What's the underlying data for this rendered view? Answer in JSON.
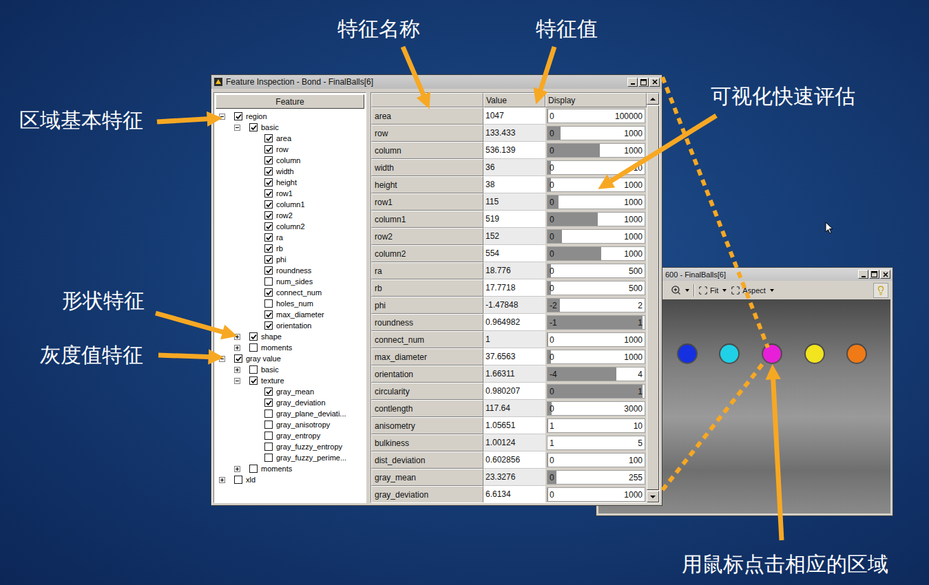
{
  "main_window": {
    "title": "Feature Inspection - Bond - FinalBalls[6]",
    "tree_header": "Feature",
    "tree": [
      {
        "label": "region",
        "kind": "branch",
        "level": 0,
        "expanded": true,
        "checked": true
      },
      {
        "label": "basic",
        "kind": "branch",
        "level": 1,
        "expanded": true,
        "checked": true
      },
      {
        "label": "area",
        "kind": "leaf",
        "level": 2,
        "checked": true
      },
      {
        "label": "row",
        "kind": "leaf",
        "level": 2,
        "checked": true
      },
      {
        "label": "column",
        "kind": "leaf",
        "level": 2,
        "checked": true
      },
      {
        "label": "width",
        "kind": "leaf",
        "level": 2,
        "checked": true
      },
      {
        "label": "height",
        "kind": "leaf",
        "level": 2,
        "checked": true
      },
      {
        "label": "row1",
        "kind": "leaf",
        "level": 2,
        "checked": true
      },
      {
        "label": "column1",
        "kind": "leaf",
        "level": 2,
        "checked": true
      },
      {
        "label": "row2",
        "kind": "leaf",
        "level": 2,
        "checked": true
      },
      {
        "label": "column2",
        "kind": "leaf",
        "level": 2,
        "checked": true
      },
      {
        "label": "ra",
        "kind": "leaf",
        "level": 2,
        "checked": true
      },
      {
        "label": "rb",
        "kind": "leaf",
        "level": 2,
        "checked": true
      },
      {
        "label": "phi",
        "kind": "leaf",
        "level": 2,
        "checked": true
      },
      {
        "label": "roundness",
        "kind": "leaf",
        "level": 2,
        "checked": true
      },
      {
        "label": "num_sides",
        "kind": "leaf",
        "level": 2,
        "checked": false
      },
      {
        "label": "connect_num",
        "kind": "leaf",
        "level": 2,
        "checked": true
      },
      {
        "label": "holes_num",
        "kind": "leaf",
        "level": 2,
        "checked": false
      },
      {
        "label": "max_diameter",
        "kind": "leaf",
        "level": 2,
        "checked": true
      },
      {
        "label": "orientation",
        "kind": "leaf",
        "level": 2,
        "checked": true
      },
      {
        "label": "shape",
        "kind": "branch",
        "level": 1,
        "expanded": false,
        "checked": true
      },
      {
        "label": "moments",
        "kind": "branch",
        "level": 1,
        "expanded": false,
        "checked": false
      },
      {
        "label": "gray value",
        "kind": "branch",
        "level": 0,
        "expanded": true,
        "checked": true
      },
      {
        "label": "basic",
        "kind": "branch",
        "level": 1,
        "expanded": false,
        "checked": false
      },
      {
        "label": "texture",
        "kind": "branch",
        "level": 1,
        "expanded": true,
        "checked": true
      },
      {
        "label": "gray_mean",
        "kind": "leaf",
        "level": 2,
        "checked": true
      },
      {
        "label": "gray_deviation",
        "kind": "leaf",
        "level": 2,
        "checked": true
      },
      {
        "label": "gray_plane_deviati...",
        "kind": "leaf",
        "level": 2,
        "checked": false
      },
      {
        "label": "gray_anisotropy",
        "kind": "leaf",
        "level": 2,
        "checked": false
      },
      {
        "label": "gray_entropy",
        "kind": "leaf",
        "level": 2,
        "checked": false
      },
      {
        "label": "gray_fuzzy_entropy",
        "kind": "leaf",
        "level": 2,
        "checked": false
      },
      {
        "label": "gray_fuzzy_perime...",
        "kind": "leaf",
        "level": 2,
        "checked": false
      },
      {
        "label": "moments",
        "kind": "branch",
        "level": 1,
        "expanded": false,
        "checked": false
      },
      {
        "label": "xld",
        "kind": "branch",
        "level": 0,
        "expanded": false,
        "checked": false
      }
    ],
    "table": {
      "columns": [
        "Value",
        "Display"
      ],
      "rows": [
        {
          "feature": "area",
          "value": "1047",
          "min": "0",
          "max": "100000",
          "level": 0.0105
        },
        {
          "feature": "row",
          "value": "133.433",
          "min": "0",
          "max": "1000",
          "level": 0.133
        },
        {
          "feature": "column",
          "value": "536.139",
          "min": "0",
          "max": "1000",
          "level": 0.536
        },
        {
          "feature": "width",
          "value": "36",
          "min": "0",
          "max": "10",
          "level": 0.036
        },
        {
          "feature": "height",
          "value": "38",
          "min": "0",
          "max": "1000",
          "level": 0.038
        },
        {
          "feature": "row1",
          "value": "115",
          "min": "0",
          "max": "1000",
          "level": 0.115
        },
        {
          "feature": "column1",
          "value": "519",
          "min": "0",
          "max": "1000",
          "level": 0.519
        },
        {
          "feature": "row2",
          "value": "152",
          "min": "0",
          "max": "1000",
          "level": 0.152
        },
        {
          "feature": "column2",
          "value": "554",
          "min": "0",
          "max": "1000",
          "level": 0.554
        },
        {
          "feature": "ra",
          "value": "18.776",
          "min": "0",
          "max": "500",
          "level": 0.0376
        },
        {
          "feature": "rb",
          "value": "17.7718",
          "min": "0",
          "max": "500",
          "level": 0.0355
        },
        {
          "feature": "phi",
          "value": "-1.47848",
          "min": "-2",
          "max": "2",
          "level": 0.13
        },
        {
          "feature": "roundness",
          "value": "0.964982",
          "min": "-1",
          "max": "1",
          "level": 0.982
        },
        {
          "feature": "connect_num",
          "value": "1",
          "min": "0",
          "max": "1000",
          "level": 0.001
        },
        {
          "feature": "max_diameter",
          "value": "37.6563",
          "min": "0",
          "max": "1000",
          "level": 0.0377
        },
        {
          "feature": "orientation",
          "value": "1.66311",
          "min": "-4",
          "max": "4",
          "level": 0.708
        },
        {
          "feature": "circularity",
          "value": "0.980207",
          "min": "0",
          "max": "1",
          "level": 0.98
        },
        {
          "feature": "contlength",
          "value": "117.64",
          "min": "0",
          "max": "3000",
          "level": 0.0392
        },
        {
          "feature": "anisometry",
          "value": "1.05651",
          "min": "1",
          "max": "10",
          "level": 0.0063
        },
        {
          "feature": "bulkiness",
          "value": "1.00124",
          "min": "1",
          "max": "5",
          "level": 0.0003
        },
        {
          "feature": "dist_deviation",
          "value": "0.602856",
          "min": "0",
          "max": "100",
          "level": 0.006
        },
        {
          "feature": "gray_mean",
          "value": "23.3276",
          "min": "0",
          "max": "255",
          "level": 0.0915
        },
        {
          "feature": "gray_deviation",
          "value": "6.6134",
          "min": "0",
          "max": "1000",
          "level": 0.0066
        }
      ]
    }
  },
  "image_window": {
    "title": "600 - FinalBalls[6]",
    "toolbar": [
      {
        "label": "Fit"
      },
      {
        "label": "Aspect"
      }
    ],
    "regions": [
      {
        "color": "#1530e0"
      },
      {
        "color": "#20d0e6"
      },
      {
        "color": "#e81fd8"
      },
      {
        "color": "#f2e41e"
      },
      {
        "color": "#f07a16"
      }
    ]
  },
  "annotations": [
    {
      "text": "特征名称"
    },
    {
      "text": "特征值"
    },
    {
      "text": "可视化快速评估"
    },
    {
      "text": "区域基本特征"
    },
    {
      "text": "形状特征"
    },
    {
      "text": "灰度值特征"
    },
    {
      "text": "用鼠标点击相应的区域"
    }
  ]
}
